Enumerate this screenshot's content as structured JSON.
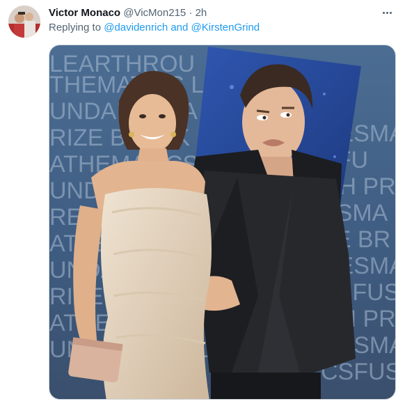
{
  "tweet": {
    "display_name": "Victor Monaco",
    "handle": "@VicMon215",
    "separator": "·",
    "time": "2h",
    "replying_prefix": "Replying to",
    "mentions": [
      "@davidenrich",
      "@KirstenGrind"
    ],
    "mention_joiner": "and",
    "more_icon": "more-horizontal-icon"
  },
  "media": {
    "backdrop_words": [
      "LEARTHROU",
      "THEMATICS LIF",
      "UNDAMENTA",
      "RIZE BREAK",
      "ATHEMATICS",
      "UNDAMENTA",
      "REAKTHROUG",
      "ATHEMATICS",
      "UNDAMENTAL",
      "RIZE BREAKTHROUGH",
      "ATHEMATICS",
      "UNDAMENTAL",
      "CESMA",
      "SFU",
      "GH PR",
      "ESMA",
      "ZE BR",
      "CESMAT",
      "ESFUS",
      "GH PRI",
      "CESMAT",
      "CSFUS"
    ],
    "colors": {
      "backdrop": "#3f5f86",
      "backdrop_text": "#a9bdd3",
      "dress": "#e7d8c3",
      "jacket": "#26272b",
      "skin": "#e2b48f",
      "inset_bg": "#2b4d9a"
    }
  }
}
